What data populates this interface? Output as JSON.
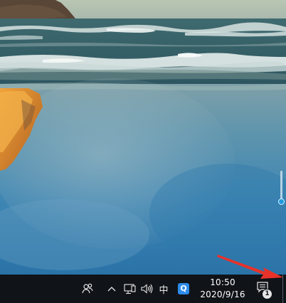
{
  "taskbar": {
    "background": "#101419",
    "tray": {
      "people_icon": "people-icon",
      "overflow_icon": "chevron-up-icon",
      "network_icon": "network-icon",
      "volume_icon": "speaker-icon",
      "ime_label": "中",
      "qq_label": "Q",
      "clock": {
        "time": "10:50",
        "date": "2020/9/16"
      },
      "notifications": {
        "icon": "action-center-icon",
        "count": "1"
      }
    }
  },
  "volume_slider": {
    "level": 0.05,
    "thumb_color": "#1e9be0"
  },
  "annotation": {
    "arrow_color": "#e8322a",
    "points_to": "show-desktop-button"
  }
}
